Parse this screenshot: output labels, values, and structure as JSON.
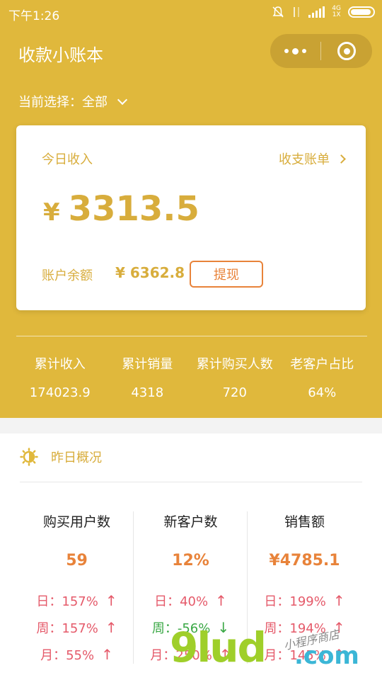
{
  "status": {
    "time": "下午1:26",
    "net_top": "4G",
    "net_bottom": "1X"
  },
  "header": {
    "title": "收款小账本"
  },
  "selector": {
    "label": "当前选择：全部"
  },
  "card": {
    "today_label": "今日收入",
    "bill_link": "收支账单",
    "currency": "¥",
    "today_amount": "3313.5",
    "balance_label": "账户余额",
    "balance_value": "¥ 6362.8",
    "withdraw_label": "提现"
  },
  "stats": [
    {
      "label": "累计收入",
      "value": "174023.9"
    },
    {
      "label": "累计销量",
      "value": "4318"
    },
    {
      "label": "累计购买人数",
      "value": "720"
    },
    {
      "label": "老客户占比",
      "value": "64%"
    }
  ],
  "yesterday": {
    "title": "昨日概况",
    "columns": [
      {
        "header": "购买用户数",
        "value": "59",
        "rows": [
          {
            "text": "日：157%",
            "trend": "up"
          },
          {
            "text": "周：157%",
            "trend": "up"
          },
          {
            "text": "月：55%",
            "trend": "up"
          }
        ]
      },
      {
        "header": "新客户数",
        "value": "12%",
        "rows": [
          {
            "text": "日：40%",
            "trend": "up"
          },
          {
            "text": "周：-56%",
            "trend": "down"
          },
          {
            "text": "月：250%",
            "trend": "up"
          }
        ]
      },
      {
        "header": "销售额",
        "value": "¥4785.1",
        "rows": [
          {
            "text": "日：199%",
            "trend": "up"
          },
          {
            "text": "周：194%",
            "trend": "up"
          },
          {
            "text": "月：145%",
            "trend": "up"
          }
        ]
      }
    ]
  },
  "arrows": {
    "up": "↑",
    "down": "↓"
  },
  "watermark": {
    "main": "9lud",
    "suffix": ".com",
    "sign": "小程序商店"
  },
  "colors": {
    "brand": "#e0b83c",
    "accent": "#e8833a",
    "up": "#e55a6a",
    "down": "#3aa845"
  },
  "icons": {
    "sun": "sun-icon",
    "more": "more-dots-icon",
    "target": "target-icon"
  }
}
